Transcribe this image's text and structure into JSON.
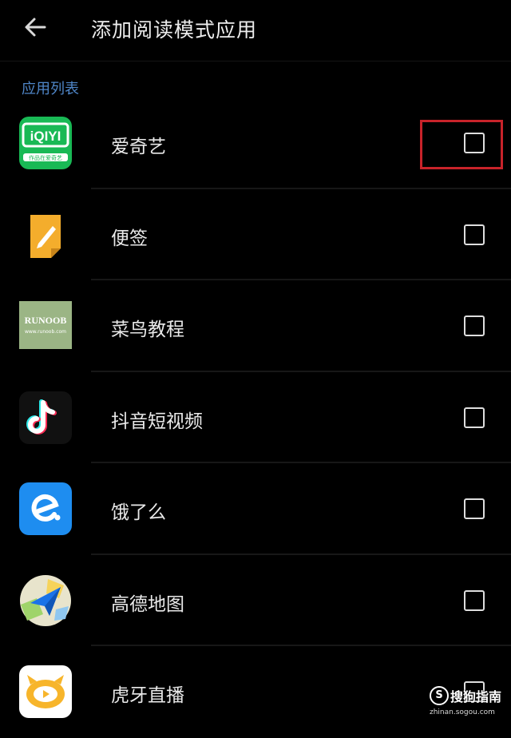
{
  "header": {
    "back_icon": "arrow-left-icon",
    "title": "添加阅读模式应用"
  },
  "section_label": "应用列表",
  "apps": [
    {
      "name": "爱奇艺",
      "icon": "iqiyi-icon",
      "checked": false
    },
    {
      "name": "便签",
      "icon": "notes-icon",
      "checked": false
    },
    {
      "name": "菜鸟教程",
      "icon": "runoob-icon",
      "checked": false
    },
    {
      "name": "抖音短视频",
      "icon": "tiktok-icon",
      "checked": false
    },
    {
      "name": "饿了么",
      "icon": "eleme-icon",
      "checked": false
    },
    {
      "name": "高德地图",
      "icon": "amap-icon",
      "checked": false
    },
    {
      "name": "虎牙直播",
      "icon": "huya-icon",
      "checked": false
    }
  ],
  "icon_text": {
    "iqiyi_logo": "iQIYI",
    "iqiyi_sub": "作品在爱奇艺",
    "runoob_logo": "RUNOOB",
    "runoob_url": "www.runoob.com"
  },
  "watermark": {
    "symbol": "S",
    "text": "搜狗指南",
    "url": "zhinan.sogou.com"
  },
  "colors": {
    "background": "#000000",
    "section_label": "#4f86c8",
    "highlight": "#c8232a",
    "iqiyi_green": "#19b955",
    "eleme_blue": "#1e8df0"
  }
}
